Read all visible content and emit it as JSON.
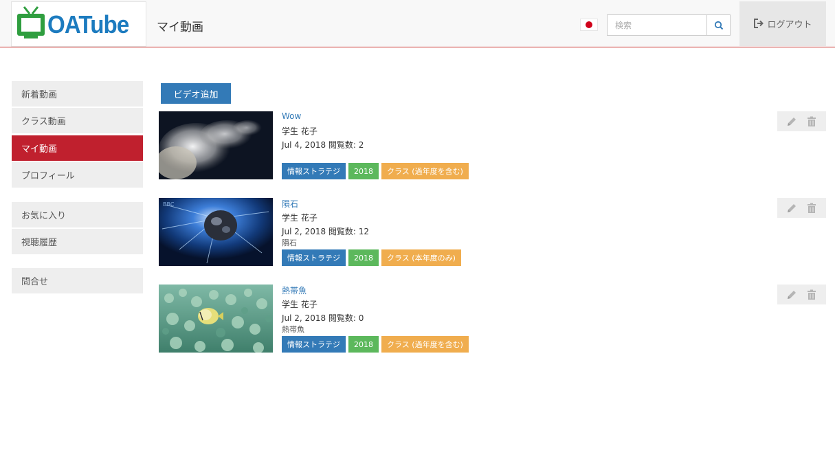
{
  "header": {
    "logo_text": "OATube",
    "page_title": "マイ動画",
    "search_placeholder": "検索",
    "logout_label": "ログアウト"
  },
  "sidebar": {
    "items": [
      {
        "label": "新着動画",
        "active": false
      },
      {
        "label": "クラス動画",
        "active": false
      },
      {
        "label": "マイ動画",
        "active": true
      },
      {
        "label": "プロフィール",
        "active": false
      },
      {
        "label": "お気に入り",
        "active": false
      },
      {
        "label": "視聴履歴",
        "active": false
      },
      {
        "label": "問合せ",
        "active": false
      }
    ]
  },
  "main": {
    "add_video_label": "ビデオ追加",
    "videos": [
      {
        "title": "Wow",
        "author": "学生 花子",
        "meta": "Jul 4, 2018 閲覧数: 2",
        "description": "",
        "tags": [
          "情報ストラテジ",
          "2018",
          "クラス (過年度を含む)"
        ]
      },
      {
        "title": "隕石",
        "author": "学生 花子",
        "meta": "Jul 2, 2018 閲覧数: 12",
        "description": "隕石",
        "tags": [
          "情報ストラテジ",
          "2018",
          "クラス (本年度のみ)"
        ]
      },
      {
        "title": "熱帯魚",
        "author": "学生 花子",
        "meta": "Jul 2, 2018 閲覧数: 0",
        "description": "熱帯魚",
        "tags": [
          "情報ストラテジ",
          "2018",
          "クラス (過年度を含む)"
        ]
      }
    ]
  },
  "colors": {
    "brand": "#1c7bbf",
    "active": "#c0202e",
    "primary": "#337ab7",
    "success": "#5cb85c",
    "warning": "#f0ad4e"
  },
  "icons": [
    "tv-icon",
    "japan-flag-icon",
    "search-icon",
    "logout-icon",
    "pencil-icon",
    "trash-icon"
  ]
}
